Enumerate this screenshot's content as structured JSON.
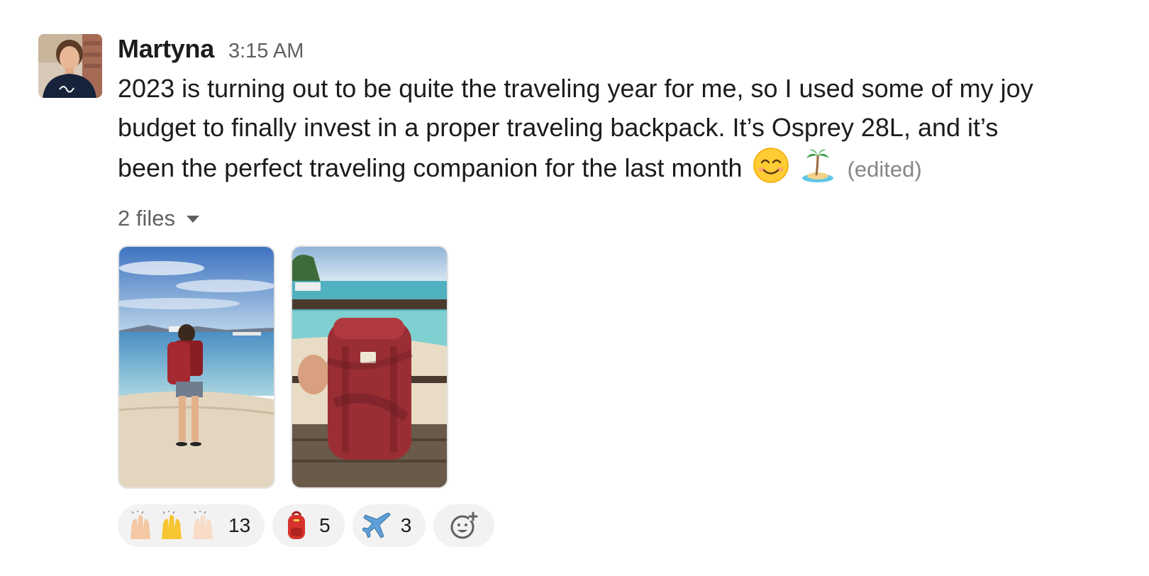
{
  "message": {
    "author": "Martyna",
    "timestamp": "3:15 AM",
    "text": "2023 is turning out to be quite the traveling year for me, so I used some of my joy budget to finally invest in a proper traveling backpack. It’s Osprey 28L, and it’s been the perfect traveling companion for the last month",
    "trailing_emoji": [
      "smiling-face-emoji",
      "desert-island-emoji"
    ],
    "edited_label": "(edited)",
    "files_label": "2 files",
    "files": [
      {
        "icon": "beach-photo-person-backpack"
      },
      {
        "icon": "beach-photo-backpack-railing"
      }
    ],
    "reactions": [
      {
        "emoji": "raising-hands-emoji",
        "count": "13"
      },
      {
        "emoji": "backpack-emoji",
        "count": "5"
      },
      {
        "emoji": "airplane-emoji",
        "count": "3"
      }
    ],
    "add_reaction_icon": "add-reaction-icon"
  },
  "colors": {
    "text": "#1d1c1d",
    "muted": "#616061",
    "edited": "#868686",
    "reaction_bg": "#f2f2f2"
  }
}
